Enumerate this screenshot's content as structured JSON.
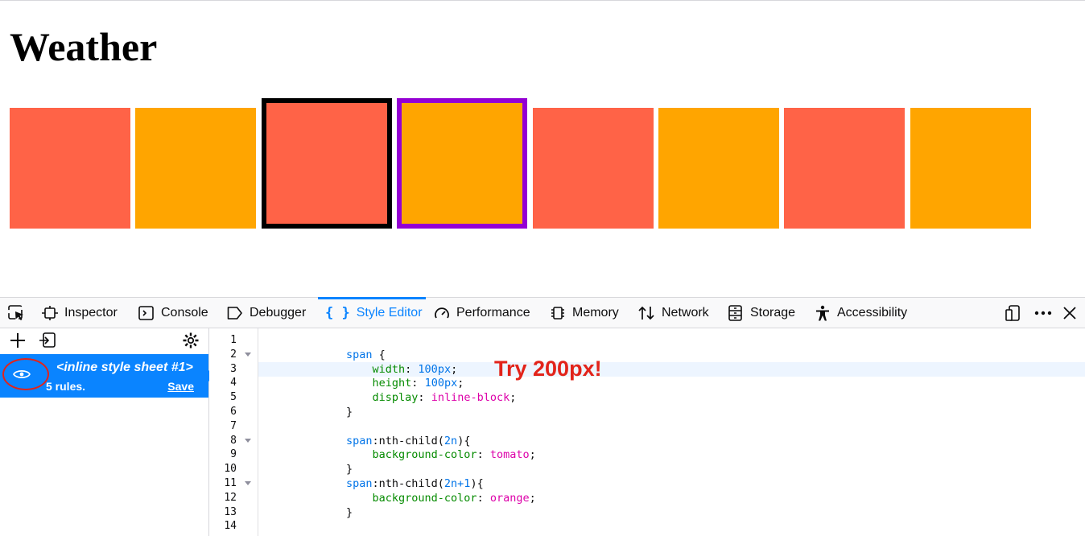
{
  "page": {
    "title": "Weather"
  },
  "boxes": [
    {
      "color": "tomato",
      "outline": "none"
    },
    {
      "color": "orange",
      "outline": "none"
    },
    {
      "color": "tomato",
      "outline": "#000000"
    },
    {
      "color": "orange",
      "outline": "#9400d3"
    },
    {
      "color": "tomato",
      "outline": "none"
    },
    {
      "color": "orange",
      "outline": "none"
    },
    {
      "color": "tomato",
      "outline": "none"
    },
    {
      "color": "orange",
      "outline": "none"
    }
  ],
  "devtools": {
    "tabs": [
      {
        "label": "Inspector",
        "icon": "inspector-icon"
      },
      {
        "label": "Console",
        "icon": "console-icon"
      },
      {
        "label": "Debugger",
        "icon": "debugger-icon"
      },
      {
        "label": "Style Editor",
        "icon": "braces-icon",
        "active": true
      },
      {
        "label": "Performance",
        "icon": "gauge-icon"
      },
      {
        "label": "Memory",
        "icon": "chip-icon"
      },
      {
        "label": "Network",
        "icon": "arrows-icon"
      },
      {
        "label": "Storage",
        "icon": "storage-icon"
      },
      {
        "label": "Accessibility",
        "icon": "accessibility-icon"
      }
    ],
    "accent_color": "#0a84ff",
    "stylesheet": {
      "name": "<inline style sheet #1>",
      "rules": "5 rules.",
      "save_label": "Save"
    },
    "line_numbers": [
      "1",
      "2",
      "3",
      "4",
      "5",
      "6",
      "7",
      "8",
      "9",
      "10",
      "11",
      "12",
      "13",
      "14"
    ],
    "code": [
      "",
      "span {",
      "    width: 100px;",
      "    height: 100px;",
      "    display: inline-block;",
      "}",
      "",
      "span:nth-child(2n){",
      "    background-color: tomato;",
      "}",
      "span:nth-child(2n+1){",
      "    background-color: orange;",
      "}",
      ""
    ],
    "annotation": "Try 200px!"
  }
}
